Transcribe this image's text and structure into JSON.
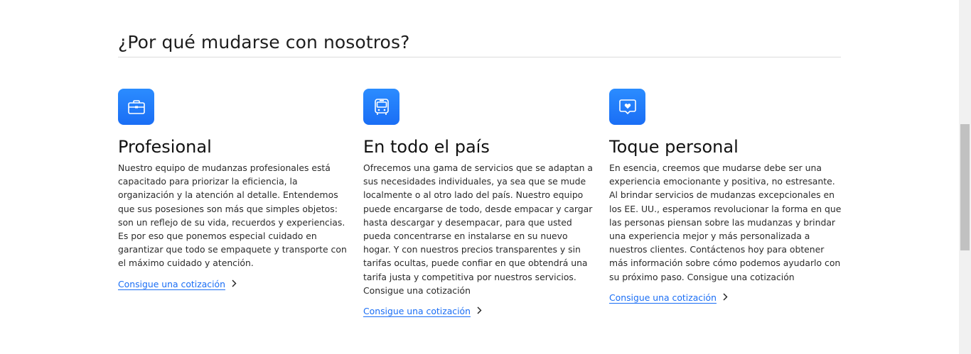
{
  "section": {
    "title": "¿Por qué mudarse con nosotros?"
  },
  "features": [
    {
      "icon": "briefcase-icon",
      "title": "Profesional",
      "text": "Nuestro equipo de mudanzas profesionales está capacitado para priorizar la eficiencia, la organización y la atención al detalle. Entendemos que sus posesiones son más que simples objetos: son un reflejo de su vida, recuerdos y experiencias. Es por eso que ponemos especial cuidado en garantizar que todo se empaquete y transporte con el máximo cuidado y atención.",
      "link": "Consigue una cotización"
    },
    {
      "icon": "bus-icon",
      "title": "En todo el país",
      "text": "Ofrecemos una gama de servicios que se adaptan a sus necesidades individuales, ya sea que se mude localmente o al otro lado del país. Nuestro equipo puede encargarse de todo, desde empacar y cargar hasta descargar y desempacar, para que usted pueda concentrarse en instalarse en su nuevo hogar. Y con nuestros precios transparentes y sin tarifas ocultas, puede confiar en que obtendrá una tarifa justa y competitiva por nuestros servicios. Consigue una cotización",
      "link": "Consigue una cotización"
    },
    {
      "icon": "heart-chat-icon",
      "title": "Toque personal",
      "text": "En esencia, creemos que mudarse debe ser una experiencia emocionante y positiva, no estresante. Al brindar servicios de mudanzas excepcionales en los EE. UU., esperamos revolucionar la forma en que las personas piensan sobre las mudanzas y brindar una experiencia mejor y más personalizada a nuestros clientes. Contáctenos hoy para obtener más información sobre cómo podemos ayudarlo con su próximo paso. Consigue una cotización",
      "link": "Consigue una cotización"
    }
  ],
  "colors": {
    "accent": "#1a6ef5",
    "icon_bg": "#2b8cff",
    "divider": "#dcdcdc"
  }
}
